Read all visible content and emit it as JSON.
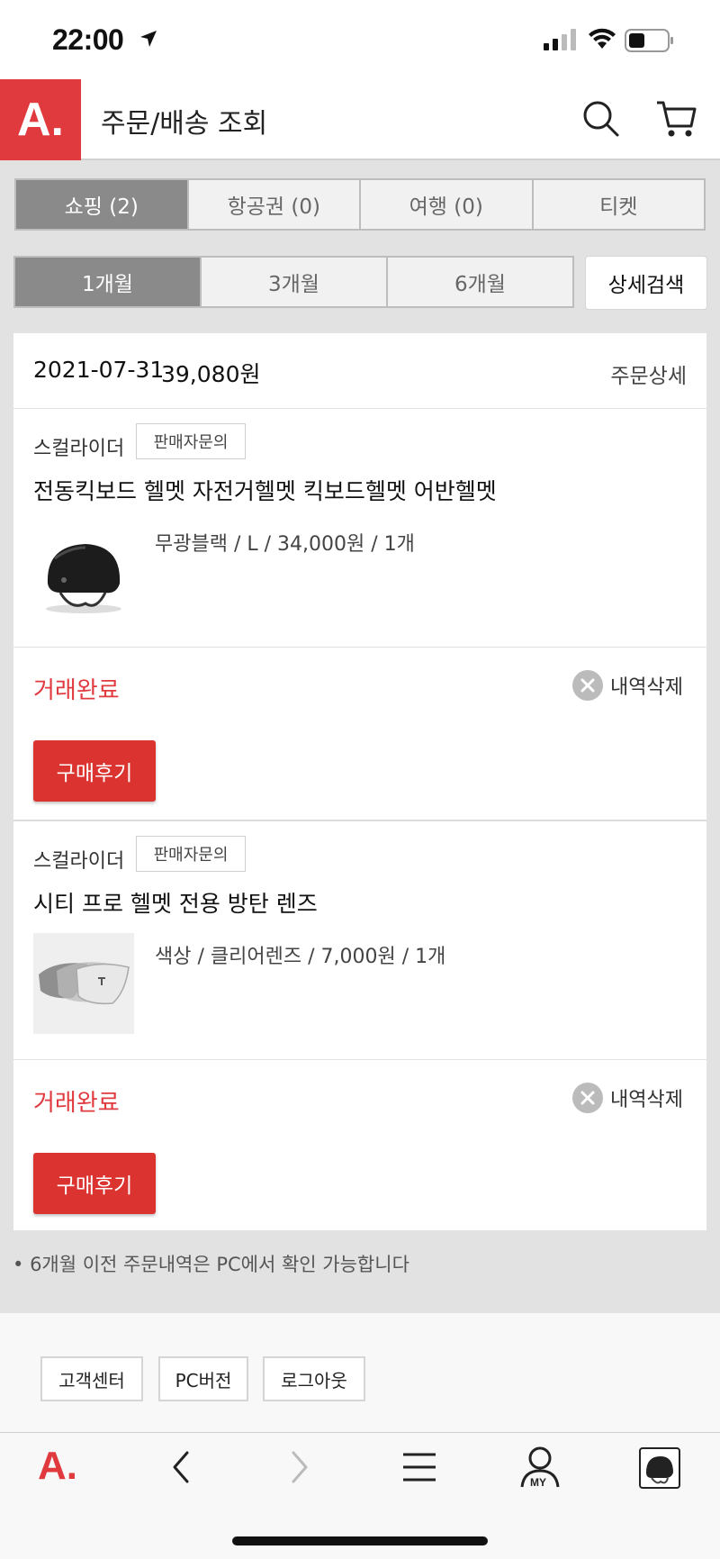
{
  "status_bar": {
    "time": "22:00"
  },
  "header": {
    "logo_text": "A.",
    "title": "주문/배송 조회"
  },
  "category_tabs": [
    {
      "label": "쇼핑 (2)",
      "active": true
    },
    {
      "label": "항공권 (0)",
      "active": false
    },
    {
      "label": "여행 (0)",
      "active": false
    },
    {
      "label": "티켓",
      "active": false
    }
  ],
  "period_tabs": [
    {
      "label": "1개월",
      "active": true
    },
    {
      "label": "3개월",
      "active": false
    },
    {
      "label": "6개월",
      "active": false
    }
  ],
  "detail_search_label": "상세검색",
  "order": {
    "date": "2021-07-31",
    "amount": "39,080원",
    "detail_label": "주문상세",
    "items": [
      {
        "seller": "스컬라이더",
        "inquiry_label": "판매자문의",
        "product_name": "전동킥보드 헬멧 자전거헬멧 킥보드헬멧 어반헬멧",
        "option": "무광블랙 / L / 34,000원 / 1개",
        "thumb_icon": "helmet-icon",
        "status": "거래완료",
        "delete_label": "내역삭제",
        "review_label": "구매후기"
      },
      {
        "seller": "스컬라이더",
        "inquiry_label": "판매자문의",
        "product_name": "시티 프로 헬멧 전용 방탄 렌즈",
        "option": "색상 / 클리어렌즈 / 7,000원 / 1개",
        "thumb_icon": "visor-lens-icon",
        "status": "거래완료",
        "delete_label": "내역삭제",
        "review_label": "구매후기"
      }
    ]
  },
  "note": "6개월 이전 주문내역은 PC에서 확인 가능합니다",
  "footer": {
    "customer_center": "고객센터",
    "pc_version": "PC버전",
    "logout": "로그아웃"
  },
  "toolbar": {
    "logo_text": "A.",
    "my_label": "MY"
  },
  "colors": {
    "brand": "#e0393e",
    "active_tab": "#8a8a8a",
    "review_button": "#db3330"
  }
}
